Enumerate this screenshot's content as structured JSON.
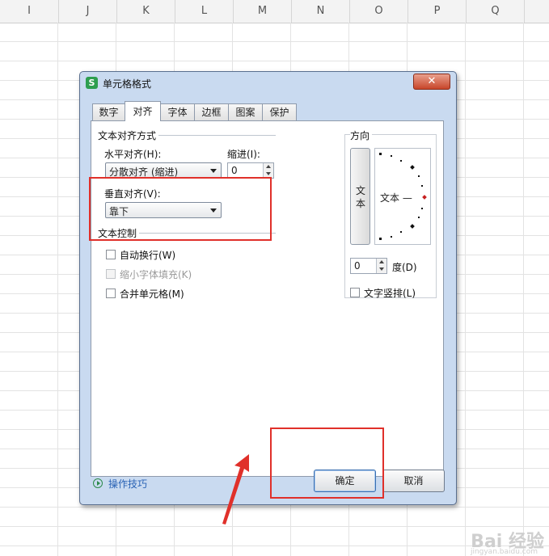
{
  "sheet": {
    "columns": [
      "I",
      "J",
      "K",
      "L",
      "M",
      "N",
      "O",
      "P",
      "Q"
    ]
  },
  "dialog": {
    "app_icon_glyph": "S",
    "title": "单元格格式",
    "close_glyph": "✕",
    "tabs": [
      {
        "label": "数字"
      },
      {
        "label": "对齐"
      },
      {
        "label": "字体"
      },
      {
        "label": "边框"
      },
      {
        "label": "图案"
      },
      {
        "label": "保护"
      }
    ],
    "active_tab": "对齐",
    "text_align": {
      "group_title": "文本对齐方式",
      "horizontal_label": "水平对齐(H):",
      "horizontal_value": "分散对齐 (缩进)",
      "indent_label": "缩进(I):",
      "indent_value": "0",
      "vertical_label": "垂直对齐(V):",
      "vertical_value": "靠下"
    },
    "text_control": {
      "group_title": "文本控制",
      "wrap_label": "自动换行(W)",
      "shrink_label": "缩小字体填充(K)",
      "merge_label": "合并单元格(M)"
    },
    "orientation": {
      "group_title": "方向",
      "vertical_button_text": "文本",
      "dial_text": "文本 —",
      "degree_value": "0",
      "degree_label": "度(D)",
      "vertical_text_label": "文字竖排(L)"
    },
    "tips_link": "操作技巧",
    "ok_label": "确定",
    "cancel_label": "取消"
  },
  "watermark": {
    "text": "Bai 经验",
    "sub": "jingyan.baidu.com"
  },
  "colors": {
    "annotation": "#e0302a",
    "title_bar": "#c9daf0",
    "link": "#2a63b5"
  }
}
